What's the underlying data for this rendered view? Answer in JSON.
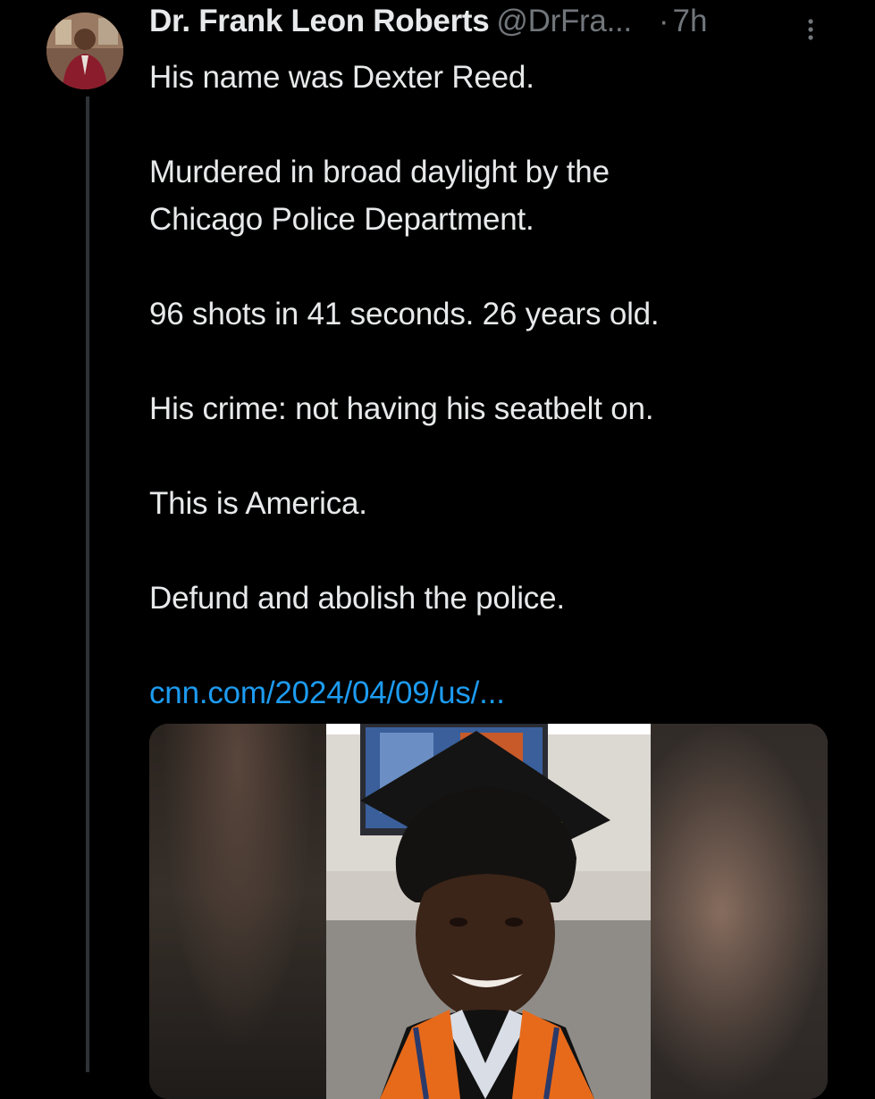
{
  "tweet": {
    "author": {
      "display_name": "Dr. Frank Leon Roberts",
      "handle": "@DrFra...",
      "avatar_icon": "user-avatar"
    },
    "separator": "·",
    "timestamp": "7h",
    "more_icon": "more-vertical-icon",
    "paragraphs": [
      "His name was Dexter Reed.",
      "Murdered in broad daylight by the Chicago Police Department.",
      "96 shots in 41 seconds. 26 years old.",
      "His crime: not having his seatbelt on.",
      "This is America.",
      "Defund and abolish the police."
    ],
    "link_text": "cnn.com/2024/04/09/us/...",
    "media": {
      "type": "photo",
      "subject": "graduation-portrait"
    }
  },
  "colors": {
    "background": "#000000",
    "text_primary": "#e7e9ea",
    "text_secondary": "#71767b",
    "link": "#1d9bf0",
    "thread_line": "#2f3336"
  }
}
